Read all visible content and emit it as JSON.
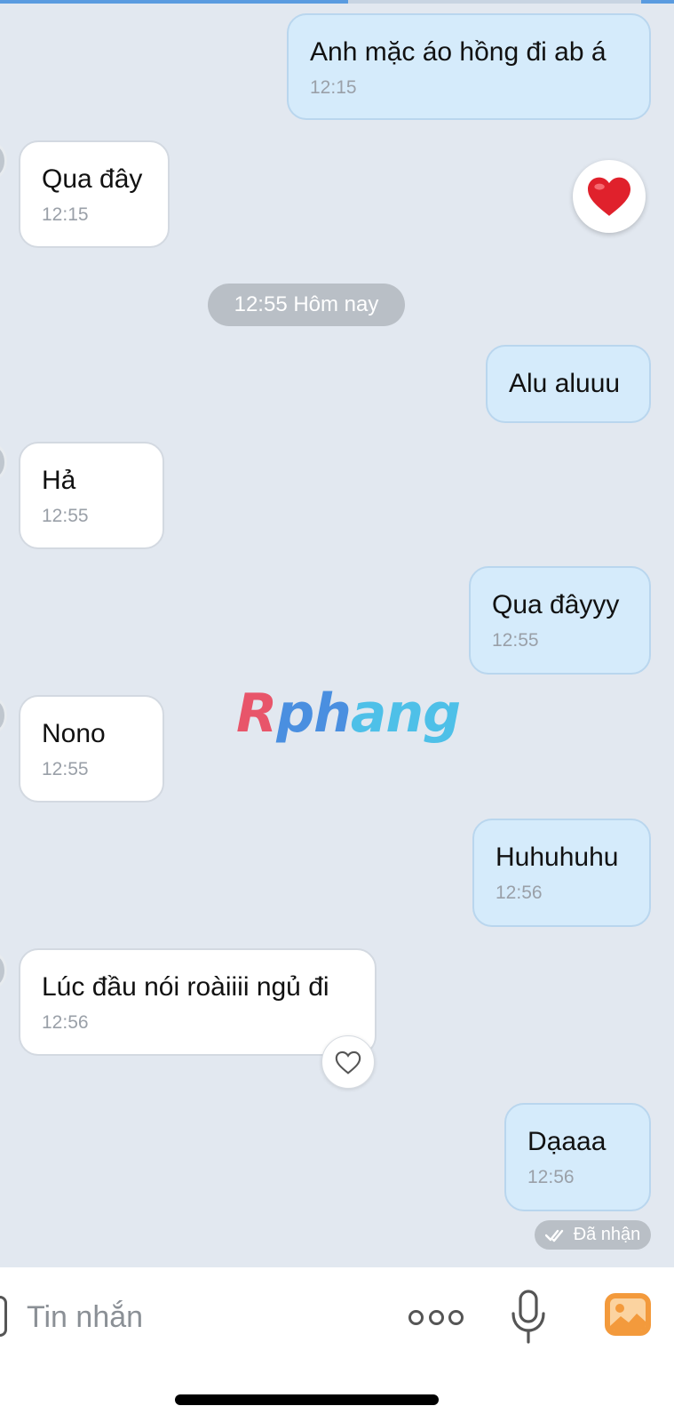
{
  "messages": [
    {
      "text": "Anh mặc áo hồng đi ab á",
      "time": "12:15"
    },
    {
      "text": "Qua đây",
      "time": "12:15",
      "reaction": "heart"
    },
    {
      "text": "Alu aluuu"
    },
    {
      "text": "Hả",
      "time": "12:55"
    },
    {
      "text": "Qua đâyyy",
      "time": "12:55"
    },
    {
      "text": "Nono",
      "time": "12:55"
    },
    {
      "text": "Huhuhuhu",
      "time": "12:56"
    },
    {
      "text": "Lúc đầu nói roàiiii ngủ đi",
      "time": "12:56"
    },
    {
      "text": "Dạaaa",
      "time": "12:56"
    }
  ],
  "date_divider": "12:55 Hôm nay",
  "status": "Đã nhận",
  "watermark": "Rphang",
  "composer": {
    "placeholder": "Tin nhắn"
  },
  "colors": {
    "background": "#e2e8f0",
    "outgoing_bubble": "#d5ebfb",
    "incoming_bubble": "#ffffff",
    "chip": "#b9bfc6",
    "heart": "#e0212c",
    "gallery_icon": "#f39a3c"
  },
  "icons": [
    "heart-reaction-icon",
    "heart-outline-icon",
    "double-check-icon",
    "more-icon",
    "microphone-icon",
    "gallery-icon"
  ]
}
